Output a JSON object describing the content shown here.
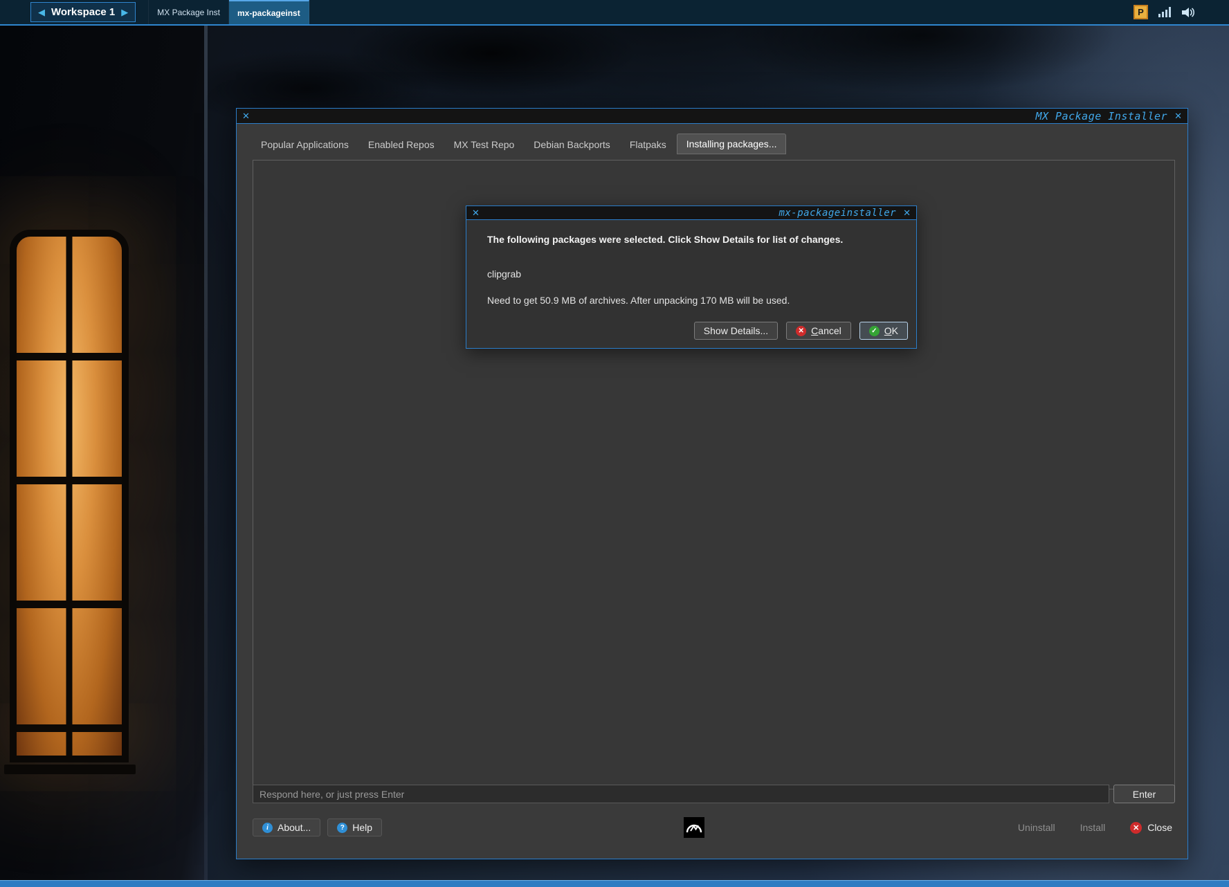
{
  "taskbar": {
    "prev_arrow": "◀",
    "next_arrow": "▶",
    "workspace_label": "Workspace 1",
    "tasks": [
      {
        "label": "MX Package Inst"
      },
      {
        "label": "mx-packageinst"
      }
    ],
    "tray": {
      "package_icon_letter": "P"
    }
  },
  "window": {
    "title": "MX Package Installer",
    "close_glyph": "✕",
    "tabs": [
      {
        "label": "Popular Applications"
      },
      {
        "label": "Enabled Repos"
      },
      {
        "label": "MX Test Repo"
      },
      {
        "label": "Debian Backports"
      },
      {
        "label": "Flatpaks"
      },
      {
        "label": "Installing packages..."
      }
    ],
    "respond_input": {
      "placeholder": "Respond here, or just press Enter"
    },
    "enter_button": "Enter",
    "toolbar": {
      "about": "About...",
      "help": "Help",
      "uninstall": "Uninstall",
      "install": "Install",
      "close": "Close"
    }
  },
  "dialog": {
    "title": "mx-packageinstaller",
    "close_glyph": "✕",
    "message": "The following packages were selected. Click Show Details for list of changes.",
    "package_name": "clipgrab",
    "size_info": "Need to get 50.9 MB of archives. After unpacking 170 MB will be used.",
    "buttons": {
      "show_details": "Show Details...",
      "cancel": "Cancel",
      "ok": "OK"
    }
  },
  "icons": {
    "cross": "✕",
    "check": "✓",
    "info": "i",
    "question": "?"
  },
  "colors": {
    "accent_blue": "#2b7ecb",
    "title_blue": "#41a8ea",
    "cancel_red": "#cf2b2b",
    "ok_green": "#35a435",
    "taskbar_bg": "#0b2333"
  }
}
